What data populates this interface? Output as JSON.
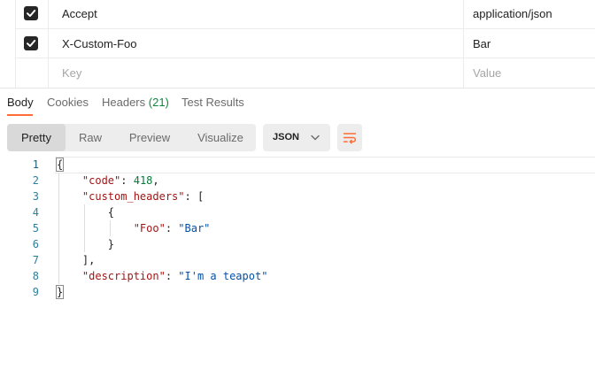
{
  "headers_table": {
    "rows": [
      {
        "checked": true,
        "key": "Accept",
        "value": "application/json"
      },
      {
        "checked": true,
        "key": "X-Custom-Foo",
        "value": "Bar"
      }
    ],
    "new_row": {
      "key_placeholder": "Key",
      "value_placeholder": "Value"
    }
  },
  "response_tabs": {
    "body": "Body",
    "cookies": "Cookies",
    "headers": "Headers",
    "headers_count": "(21)",
    "test_results": "Test Results",
    "active": "Body"
  },
  "toolbar": {
    "views": [
      "Pretty",
      "Raw",
      "Preview",
      "Visualize"
    ],
    "active_view": "Pretty",
    "format": "JSON",
    "format_icon": "chevron-down-icon",
    "wrap_icon": "wrap-lines-icon"
  },
  "editor": {
    "line_numbers": [
      "1",
      "2",
      "3",
      "4",
      "5",
      "6",
      "7",
      "8",
      "9"
    ],
    "code": {
      "l1_open": "{",
      "l2_key": "\"code\"",
      "l2_colon": ": ",
      "l2_val": "418",
      "l2_comma": ",",
      "l3_key": "\"custom_headers\"",
      "l3_rest": ": [",
      "l4": "{",
      "l5_key": "\"Foo\"",
      "l5_colon": ": ",
      "l5_val": "\"Bar\"",
      "l6": "}",
      "l7": "],",
      "l8_key": "\"description\"",
      "l8_colon": ": ",
      "l8_val": "\"I'm a teapot\"",
      "l9_close": "}"
    }
  },
  "colors": {
    "accent": "#ff6c37",
    "json_key": "#a31515",
    "json_number": "#0a7a3d",
    "json_string": "#0451a5",
    "line_number": "#2f7f9c"
  }
}
